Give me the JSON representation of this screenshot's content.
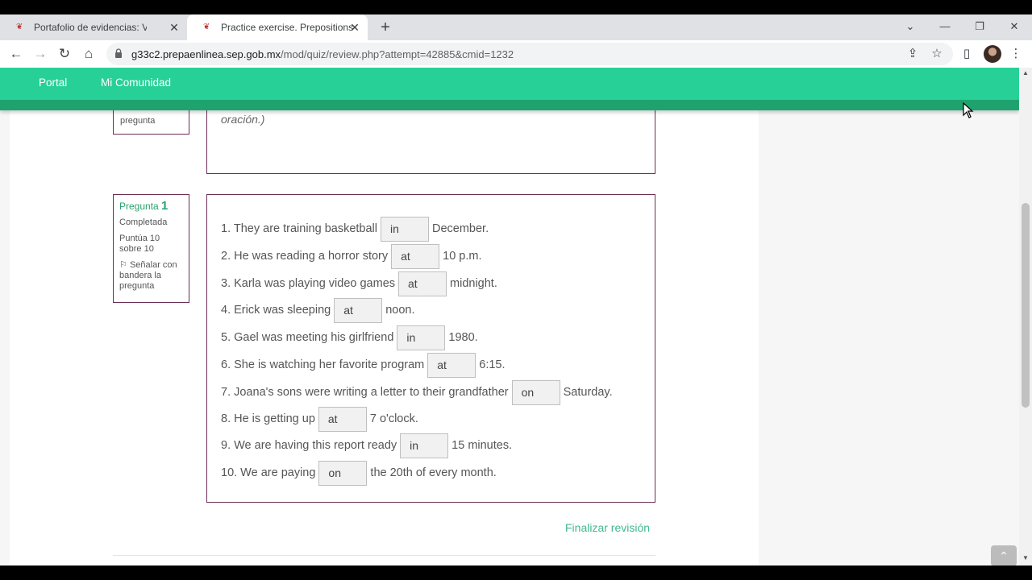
{
  "tabs": [
    {
      "title": "Portafolio de evidencias: Ver",
      "close": "✕"
    },
    {
      "title": "Practice exercise. Prepositions: Re",
      "close": "✕"
    }
  ],
  "tabstrip": {
    "new_tab": "+",
    "tab_search": "⌄",
    "minimize": "—",
    "restore": "❐",
    "close": "✕"
  },
  "toolbar": {
    "back": "←",
    "forward": "→",
    "reload": "↻",
    "home": "⌂",
    "url_host": "g33c2.prepaenlinea.sep.gob.mx",
    "url_path": "/mod/quiz/review.php?attempt=42885&cmid=1232",
    "share": "⇪",
    "bookmark": "☆",
    "sidepanel": "▯",
    "menu": "⋮"
  },
  "navbar": {
    "links": [
      "Portal",
      "Mi Comunidad"
    ]
  },
  "prev_question": {
    "info_label": "pregunta",
    "text": "oración.)"
  },
  "question": {
    "number_prefix": "Pregunta",
    "number": "1",
    "state": "Completada",
    "grade": "Puntúa 10 sobre 10",
    "flag": "Señalar con bandera la pregunta",
    "flag_icon": "⚐",
    "sentences": [
      {
        "before": "1. They are training basketball",
        "answer": "in",
        "after": "December."
      },
      {
        "before": "2. He was reading a horror story",
        "answer": "at",
        "after": "10 p.m."
      },
      {
        "before": "3. Karla was playing video games",
        "answer": "at",
        "after": "midnight."
      },
      {
        "before": "4. Erick was sleeping",
        "answer": "at",
        "after": "noon."
      },
      {
        "before": "5. Gael was meeting his girlfriend",
        "answer": "in",
        "after": "1980."
      },
      {
        "before": "6. She is watching her favorite program",
        "answer": "at",
        "after": "6:15."
      },
      {
        "before": "7. Joana's sons were writing a letter to their grandfather",
        "answer": "on",
        "after": "Saturday."
      },
      {
        "before": "8. He is getting up",
        "answer": "at",
        "after": "7 o'clock."
      },
      {
        "before": "9. We are having this report ready",
        "answer": "in",
        "after": "15 minutes."
      },
      {
        "before": "10. We are paying",
        "answer": "on",
        "after": "the 20th of every month."
      }
    ]
  },
  "footer": {
    "finish_review": "Finalizar revisión",
    "back_to_top": "⌃"
  },
  "scrollbar": {
    "up": "▲",
    "down": "▼"
  },
  "colors": {
    "navbar": "#27d097",
    "navbar_strip": "#1fa36e",
    "question_border": "#6b2f55",
    "link": "#41b98c"
  }
}
